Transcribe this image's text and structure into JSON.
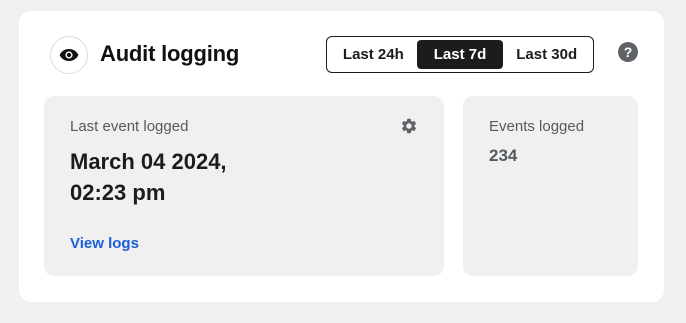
{
  "header": {
    "title": "Audit logging",
    "help_symbol": "?"
  },
  "time_range": {
    "options": [
      {
        "label": "Last 24h",
        "active": false
      },
      {
        "label": "Last 7d",
        "active": true
      },
      {
        "label": "Last 30d",
        "active": false
      }
    ]
  },
  "last_event": {
    "label": "Last event logged",
    "date": "March 04 2024,",
    "time": "02:23 pm",
    "link_label": "View logs"
  },
  "events_logged": {
    "label": "Events logged",
    "count": "234"
  },
  "colors": {
    "accent_link": "#1a5fd6",
    "active_segment": "#1c1c1c"
  }
}
